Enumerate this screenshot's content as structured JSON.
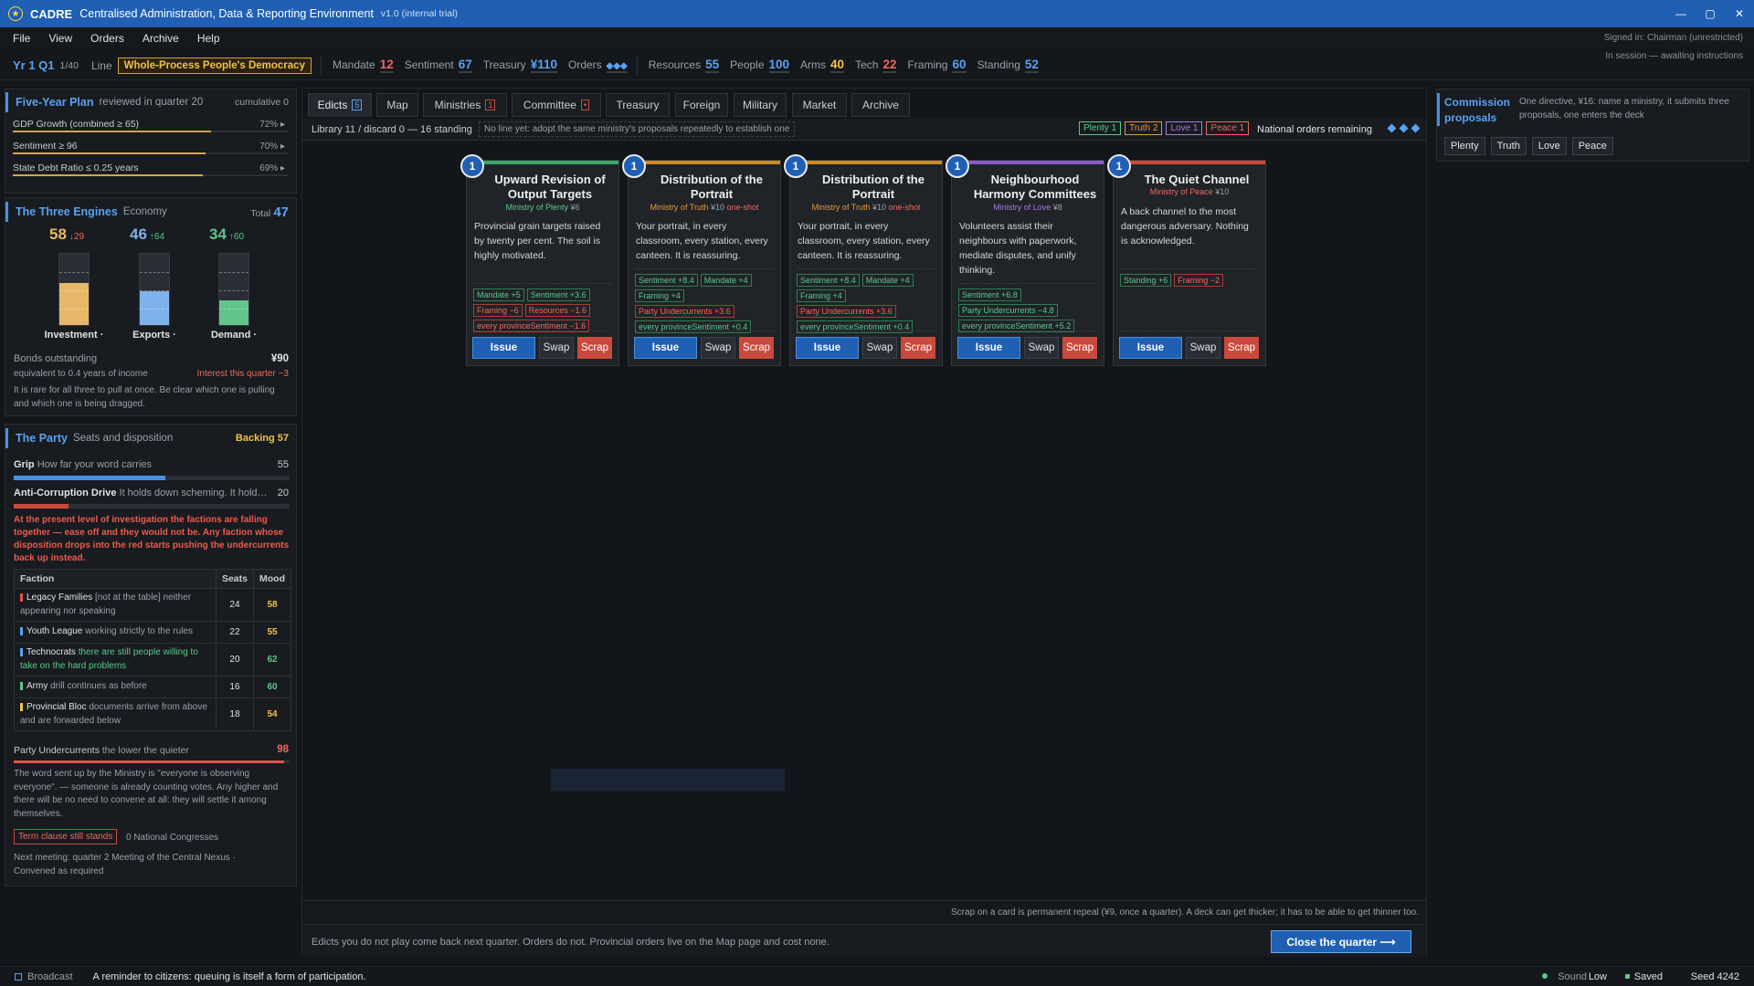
{
  "window": {
    "app": "CADRE",
    "full_title": "Centralised Administration, Data & Reporting Environment",
    "version": "v1.0 (internal trial)",
    "controls": [
      "—",
      "▢",
      "✕"
    ]
  },
  "menu": {
    "items": [
      "File",
      "View",
      "Orders",
      "Archive",
      "Help"
    ],
    "signed_in": "Signed in: Chairman (unrestricted)",
    "session": "In session — awaiting instructions"
  },
  "status": {
    "turn": "Yr 1 Q1",
    "turn_of": "1/40",
    "line_label": "Line",
    "line_value": "Whole-Process People's Democracy",
    "stats": [
      {
        "label": "Mandate",
        "value": "12",
        "color": "#ee6a5e"
      },
      {
        "label": "Sentiment",
        "value": "67",
        "color": "#5aa2f0"
      },
      {
        "label": "Treasury",
        "value": "¥110",
        "color": "#5aa2f0"
      },
      {
        "label": "Orders",
        "value": "◆◆◆",
        "color": "#5aa2f0"
      },
      {
        "label": "Resources",
        "value": "55",
        "color": "#5aa2f0"
      },
      {
        "label": "People",
        "value": "100",
        "color": "#5aa2f0"
      },
      {
        "label": "Arms",
        "value": "40",
        "color": "#f3c247"
      },
      {
        "label": "Tech",
        "value": "22",
        "color": "#ee6a5e"
      },
      {
        "label": "Framing",
        "value": "60",
        "color": "#5aa2f0"
      },
      {
        "label": "Standing",
        "value": "52",
        "color": "#5aa2f0"
      }
    ]
  },
  "plan": {
    "title": "Five-Year Plan",
    "sub": "reviewed in quarter 20",
    "cumulative": "cumulative 0",
    "goals": [
      {
        "label": "GDP Growth (combined ≥ 65)",
        "pct": "72% ▸",
        "fill": 0.72
      },
      {
        "label": "Sentiment ≥ 96",
        "pct": "70% ▸",
        "fill": 0.7
      },
      {
        "label": "State Debt Ratio ≤ 0.25 years",
        "pct": "69% ▸",
        "fill": 0.69
      }
    ]
  },
  "engines": {
    "title": "The Three Engines",
    "sub": "Economy",
    "total_label": "Total",
    "total": "47",
    "items": [
      {
        "value": "58",
        "delta": "↓29",
        "label": "Investment ·",
        "color": "#e8b86a",
        "delta_color": "#ee6a5e",
        "level": 0.58
      },
      {
        "value": "46",
        "delta": "↑64",
        "label": "Exports ·",
        "color": "#7fb2ea",
        "delta_color": "#5cc98a",
        "level": 0.46
      },
      {
        "value": "34",
        "delta": "↑60",
        "label": "Demand ·",
        "color": "#62c48a",
        "delta_color": "#5cc98a",
        "level": 0.34
      }
    ],
    "bonds_label": "Bonds outstanding",
    "bonds_value": "¥90",
    "bonds_sub": "equivalent to 0.4 years of income",
    "interest": "Interest this quarter −3",
    "note": "It is rare for all three to pull at once. Be clear which one is pulling and which one is being dragged."
  },
  "party": {
    "title": "The Party",
    "sub": "Seats and disposition",
    "backing": "Backing 57",
    "grip_label": "Grip",
    "grip_sub": "How far your word carries",
    "grip_value": "55",
    "grip_level": 0.55,
    "acd_label": "Anti-Corruption Drive",
    "acd_sub": "It holds down scheming. It hold…",
    "acd_value": "20",
    "acd_level": 0.2,
    "warning": "At the present level of investigation the factions are falling together — ease off and they would not be. Any faction whose disposition drops into the red starts pushing the undercurrents back up instead.",
    "table_headers": [
      "Faction",
      "Seats",
      "Mood"
    ],
    "factions": [
      {
        "name": "Legacy Families",
        "note": "[not at the table] neither appearing nor speaking",
        "seats": "24",
        "mood": "58",
        "color": "#e0574a",
        "mood_color": "#f3c247",
        "note_color": "#9aa1a9"
      },
      {
        "name": "Youth League",
        "note": "working strictly to the rules",
        "seats": "22",
        "mood": "55",
        "color": "#5aa2f0",
        "mood_color": "#f3c247",
        "note_color": "#9aa1a9"
      },
      {
        "name": "Technocrats",
        "note": "there are still people willing to take on the hard problems",
        "seats": "20",
        "mood": "62",
        "color": "#5aa2f0",
        "mood_color": "#5cc98a",
        "note_color": "#5cc98a"
      },
      {
        "name": "Army",
        "note": "drill continues as before",
        "seats": "16",
        "mood": "60",
        "color": "#5cc98a",
        "mood_color": "#5cc98a",
        "note_color": "#9aa1a9"
      },
      {
        "name": "Provincial Bloc",
        "note": "documents arrive from above and are forwarded below",
        "seats": "18",
        "mood": "54",
        "color": "#f3c247",
        "mood_color": "#f3c247",
        "note_color": "#9aa1a9"
      }
    ],
    "undercurrents_label": "Party Undercurrents",
    "undercurrents_sub": "the lower the quieter",
    "undercurrents_value": "98",
    "undercurrents_level": 0.98,
    "undercurrents_note": "The word sent up by the Ministry is \"everyone is observing everyone\". — someone is already counting votes. Any higher and there will be no need to convene at all: they will settle it among themselves.",
    "term_clause": "Term clause still stands",
    "congresses": "0 National Congresses",
    "next_meeting": "Next meeting: quarter 2 Meeting of the Central Nexus · Convened as required"
  },
  "tabs": [
    {
      "label": "Edicts",
      "badge": "5",
      "active": true
    },
    {
      "label": "Map"
    },
    {
      "label": "Ministries",
      "badge": "1"
    },
    {
      "label": "Committee",
      "badge": "•"
    },
    {
      "label": "Treasury"
    },
    {
      "label": "Foreign"
    },
    {
      "label": "Military"
    },
    {
      "label": "Market"
    },
    {
      "label": "Archive"
    }
  ],
  "library": {
    "counts": "Library 11 / discard 0 — 16 standing",
    "hint": "No line yet: adopt the same ministry's proposals repeatedly to establish one",
    "chips": [
      {
        "label": "Plenty 1",
        "color": "#5cc98a"
      },
      {
        "label": "Truth 2",
        "color": "#e69a3a"
      },
      {
        "label": "Love 1",
        "color": "#a77ae0"
      },
      {
        "label": "Peace 1",
        "color": "#ee6a5e"
      }
    ],
    "orders_remaining": "National orders remaining"
  },
  "cards": [
    {
      "num": "1",
      "title": "Upward Revision of Output Targets",
      "ministry": "Ministry of Plenty",
      "cost": "¥6",
      "tag": "",
      "bar": "#3aa86b",
      "mcolor": "#5cc98a",
      "desc": "Provincial grain targets raised by twenty per cent. The soil is highly motivated.",
      "effects": [
        {
          "t": "Mandate +5",
          "c": "g"
        },
        {
          "t": "Sentiment +3.6",
          "c": "g"
        },
        {
          "t": "Framing −6",
          "c": "r"
        },
        {
          "t": "Resources −1.6",
          "c": "r"
        },
        {
          "t": "every provinceSentiment −1.6",
          "c": "r"
        }
      ],
      "issue": "Issue",
      "swap": "Swap",
      "scrap": "Scrap"
    },
    {
      "num": "1",
      "title": "Distribution of the Portrait",
      "ministry": "Ministry of Truth",
      "cost": "¥10",
      "tag": "one-shot",
      "bar": "#c98a2a",
      "mcolor": "#e69a3a",
      "desc": "Your portrait, in every classroom, every station, every canteen. It is reassuring.",
      "effects": [
        {
          "t": "Sentiment +8.4",
          "c": "g"
        },
        {
          "t": "Mandate +4",
          "c": "g"
        },
        {
          "t": "Framing +4",
          "c": "g"
        },
        {
          "t": "Party Undercurrents +3.6",
          "c": "r"
        },
        {
          "t": "every provinceSentiment +0.4",
          "c": "g"
        }
      ],
      "issue": "Issue",
      "swap": "Swap",
      "scrap": "Scrap"
    },
    {
      "num": "1",
      "title": "Distribution of the Portrait",
      "ministry": "Ministry of Truth",
      "cost": "¥10",
      "tag": "one-shot",
      "bar": "#c98a2a",
      "mcolor": "#e69a3a",
      "desc": "Your portrait, in every classroom, every station, every canteen. It is reassuring.",
      "effects": [
        {
          "t": "Sentiment +8.4",
          "c": "g"
        },
        {
          "t": "Mandate +4",
          "c": "g"
        },
        {
          "t": "Framing +4",
          "c": "g"
        },
        {
          "t": "Party Undercurrents +3.6",
          "c": "r"
        },
        {
          "t": "every provinceSentiment +0.4",
          "c": "g"
        }
      ],
      "issue": "Issue",
      "swap": "Swap",
      "scrap": "Scrap"
    },
    {
      "num": "1",
      "title": "Neighbourhood Harmony Committees",
      "ministry": "Ministry of Love",
      "cost": "¥8",
      "tag": "",
      "bar": "#8a5ac9",
      "mcolor": "#a77ae0",
      "desc": "Volunteers assist their neighbours with paperwork, mediate disputes, and unify thinking.",
      "effects": [
        {
          "t": "Sentiment +6.8",
          "c": "g"
        },
        {
          "t": "Party Undercurrents −4.8",
          "c": "g"
        },
        {
          "t": "every provinceSentiment +5.2",
          "c": "g"
        }
      ],
      "issue": "Issue",
      "swap": "Swap",
      "scrap": "Scrap"
    },
    {
      "num": "1",
      "title": "The Quiet Channel",
      "ministry": "Ministry of Peace",
      "cost": "¥10",
      "tag": "",
      "bar": "#c94a3c",
      "mcolor": "#ee6a5e",
      "desc": "A back channel to the most dangerous adversary. Nothing is acknowledged.",
      "effects": [
        {
          "t": "Standing +6",
          "c": "g"
        },
        {
          "t": "Framing −2",
          "c": "r"
        }
      ],
      "issue": "Issue",
      "swap": "Swap",
      "scrap": "Scrap"
    }
  ],
  "footer": {
    "scrap_note": "Scrap on a card is permanent repeal (¥9, once a quarter). A deck can get thicker; it has to be able to get thinner too.",
    "edicts_note": "Edicts you do not play come back next quarter. Orders do not. Provincial orders live on the Map page and cost none.",
    "close_quarter": "Close the quarter ⟶"
  },
  "commission": {
    "title": "Commission proposals",
    "desc": "One directive, ¥16: name a ministry, it submits three proposals, one enters the deck",
    "buttons": [
      "Plenty",
      "Truth",
      "Love",
      "Peace"
    ]
  },
  "bottom": {
    "broadcast_label": "Broadcast",
    "broadcast_text": "A reminder to citizens: queuing is itself a form of participation.",
    "sound": "Sound",
    "sound_level": "Low",
    "saved": "Saved",
    "seed": "Seed 4242"
  }
}
